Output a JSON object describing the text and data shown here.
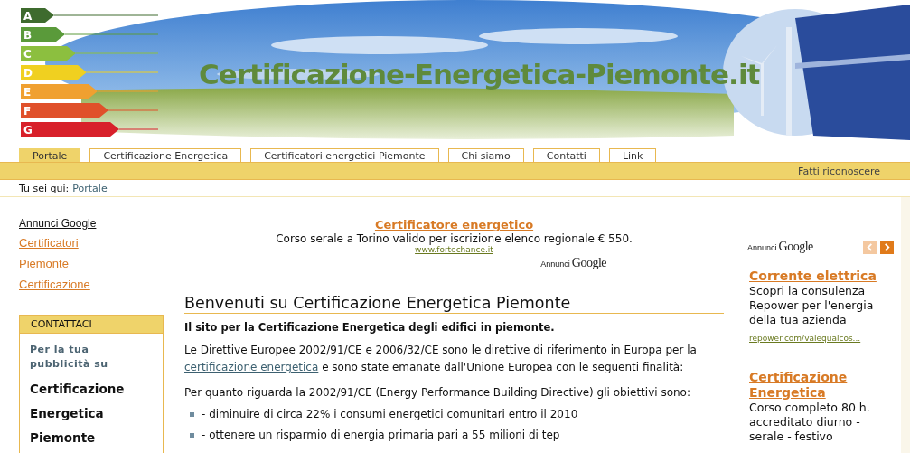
{
  "header": {
    "site_title": "Certificazione-Energetica-Piemonte.it",
    "energy_classes": [
      {
        "label": "A",
        "color": "#3e6b2e"
      },
      {
        "label": "B",
        "color": "#5a9a3a"
      },
      {
        "label": "C",
        "color": "#8cbf3f"
      },
      {
        "label": "D",
        "color": "#f0d020"
      },
      {
        "label": "E",
        "color": "#f0a030"
      },
      {
        "label": "F",
        "color": "#e0502a"
      },
      {
        "label": "G",
        "color": "#d8202a"
      }
    ]
  },
  "tabs": [
    {
      "label": "Portale",
      "selected": true
    },
    {
      "label": "Certificazione Energetica",
      "selected": false
    },
    {
      "label": "Certificatori energetici Piemonte",
      "selected": false
    },
    {
      "label": "Chi siamo",
      "selected": false
    },
    {
      "label": "Contatti",
      "selected": false
    },
    {
      "label": "Link",
      "selected": false
    }
  ],
  "nav_bar": {
    "link": "Fatti riconoscere"
  },
  "breadcrumb": {
    "label": "Tu sei qui:",
    "current": "Portale"
  },
  "sidebar": {
    "ads_title": "Annunci Google",
    "links": [
      "Certificatori",
      "Piemonte",
      "Certificazione"
    ],
    "contact_box": {
      "title": "CONTATTACI",
      "intro": "Per la tua pubblicità su",
      "lines": [
        "Certificazione",
        "Energetica",
        "Piemonte"
      ]
    }
  },
  "top_ad": {
    "title": "Certificatore energetico",
    "text": "Corso serale a Torino valido per iscrizione elenco regionale € 550.",
    "url": "www.fortechance.it",
    "label": "Annunci",
    "brand": "Google"
  },
  "article": {
    "heading": "Benvenuti su Certificazione Energetica Piemonte",
    "lead": "Il sito per la Certificazione Energetica degli edifici in piemonte.",
    "para1_before": "Le Direttive Europee 2002/91/CE e 2006/32/CE sono le direttive di riferimento in Europa per la",
    "para1_link": "certificazione energetica",
    "para1_after": "e sono state emanate dall'Unione Europea con le seguenti finalità:",
    "para2": "Per quanto riguarda la 2002/91/CE (Energy Performance Building Directive) gli obiettivi sono:",
    "bullets": [
      "- diminuire di circa 22% i consumi energetici comunitari entro il 2010",
      "- ottenere un risparmio di energia primaria pari a 55 milioni di tep"
    ]
  },
  "right_ads": {
    "label": "Annunci",
    "brand": "Google",
    "prev": {
      "disabled": true
    },
    "next": {
      "disabled": false
    },
    "ads": [
      {
        "title": "Corrente elettrica",
        "text": "Scopri la consulenza Repower per l'energia della tua azienda",
        "url": "repower.com/valequalcos..."
      },
      {
        "title": "Certificazione Energetica",
        "text": "Corso completo 80 h. accreditato diurno - serale - festivo"
      }
    ]
  }
}
